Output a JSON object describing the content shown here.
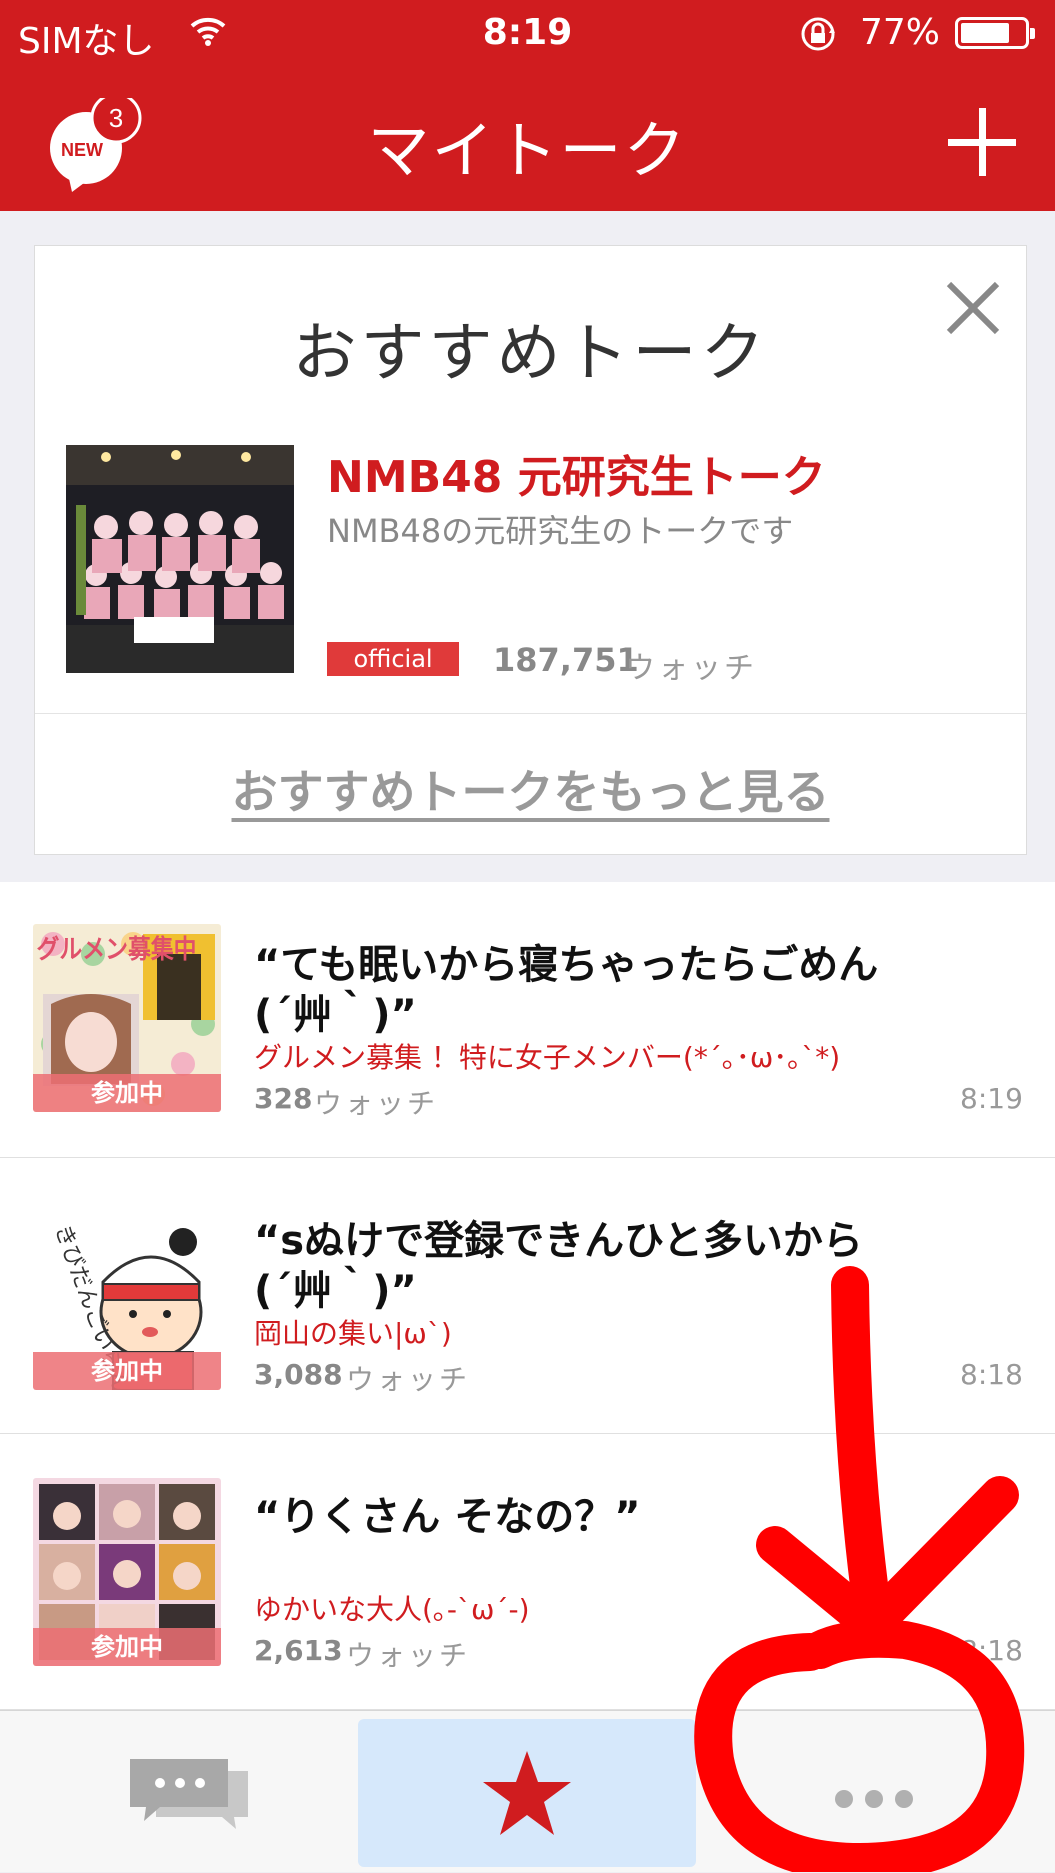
{
  "status_bar": {
    "carrier": "SIMなし",
    "time": "8:19",
    "battery_percent": "77%",
    "battery_level": 0.77
  },
  "nav": {
    "title": "マイトーク",
    "badge_label": "NEW",
    "badge_count": "3"
  },
  "recommended": {
    "heading": "おすすめトーク",
    "talk": {
      "name": "NMB48 元研究生トーク",
      "description": "NMB48の元研究生のトークです",
      "tag": "official",
      "watch_count": "187,751",
      "watch_unit": "ウォッチ"
    },
    "more_link": "おすすめトークをもっと見る"
  },
  "talks": [
    {
      "message_line1": "“ても眠いから寝ちゃったらごめん",
      "message_line2": "(´艸｀)”",
      "room": "グルメン募集 ！特に女子メンバー(*´｡･ω･｡`*)",
      "watch_count": "328",
      "watch_unit": "ウォッチ",
      "time": "8:19",
      "status": "参加中",
      "avatar_text": "グルメン募集中"
    },
    {
      "message_line1": "“sぬけで登録できんひと多いから",
      "message_line2": "(´艸｀)”",
      "room": "岡山の集い|ω`)",
      "watch_count": "3,088",
      "watch_unit": "ウォッチ",
      "time": "8:18",
      "status": "参加中",
      "avatar_text": "きびだんごいらん?"
    },
    {
      "message_line1": "“りくさん そなの？”",
      "message_line2": "",
      "room": "ゆかいな大人(｡-`ω´-)",
      "watch_count": "2,613",
      "watch_unit": "ウォッチ",
      "time": "8:18",
      "status": "参加中"
    }
  ],
  "tabs": {
    "chat": "chat-bubbles-icon",
    "favorite": "star-icon",
    "more": "more-dots-icon"
  },
  "colors": {
    "brand_red": "#d01c1f",
    "selected_tab": "#d6e8fb",
    "annotation_red": "#ff0000"
  }
}
